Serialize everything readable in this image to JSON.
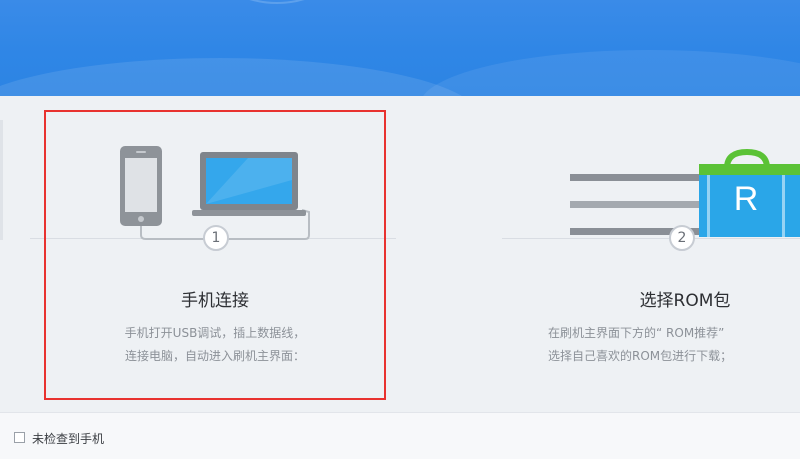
{
  "steps": [
    {
      "number": "1",
      "title": "手机连接",
      "desc_line1": "手机打开USB调试，插上数据线，",
      "desc_line2": "连接电脑，自动进入刷机主界面："
    },
    {
      "number": "2",
      "title": "选择ROM包",
      "desc_line1": "在刷机主界面下方的“ ROM推荐”",
      "desc_line2": "选择自己喜欢的ROM包进行下载；"
    }
  ],
  "rom_icon_letter": "R",
  "footer": {
    "status": "未检查到手机"
  },
  "colors": {
    "banner": "#2f86e6",
    "highlight": "#e8322f",
    "rom_green": "#5bc236",
    "rom_blue": "#2aa6e8"
  }
}
